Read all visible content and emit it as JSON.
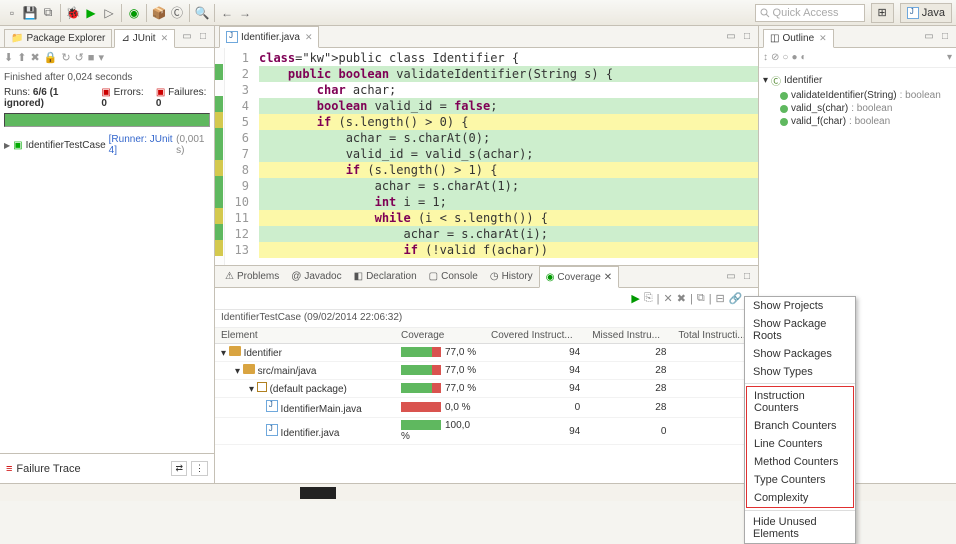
{
  "toolbar": {
    "quick_access_placeholder": "Quick Access",
    "perspective_label": "Java"
  },
  "left_tabs": {
    "pkg_explorer": "Package Explorer",
    "junit": "JUnit"
  },
  "junit": {
    "finished": "Finished after 0,024 seconds",
    "runs_label": "Runs:",
    "runs_value": "6/6 (1 ignored)",
    "errors_label": "Errors:",
    "errors_value": "0",
    "failures_label": "Failures:",
    "failures_value": "0",
    "testcase": "IdentifierTestCase",
    "runner": "[Runner: JUnit 4]",
    "time": "(0,001 s)",
    "failure_trace_label": "Failure Trace"
  },
  "editor": {
    "filename": "Identifier.java",
    "lines": [
      {
        "n": 1,
        "cov": "",
        "txt": "public class Identifier {",
        "hl": [
          "public",
          "class"
        ]
      },
      {
        "n": 2,
        "cov": "green",
        "txt": "    public boolean validateIdentifier(String s) {",
        "hl": [
          "public",
          "boolean"
        ]
      },
      {
        "n": 3,
        "cov": "",
        "txt": "        char achar;",
        "hl": [
          "char"
        ]
      },
      {
        "n": 4,
        "cov": "green",
        "txt": "        boolean valid_id = false;",
        "hl": [
          "boolean",
          "false"
        ]
      },
      {
        "n": 5,
        "cov": "yellow",
        "txt": "        if (s.length() > 0) {",
        "hl": [
          "if"
        ]
      },
      {
        "n": 6,
        "cov": "green",
        "txt": "            achar = s.charAt(0);",
        "hl": []
      },
      {
        "n": 7,
        "cov": "green",
        "txt": "            valid_id = valid_s(achar);",
        "hl": []
      },
      {
        "n": 8,
        "cov": "yellow",
        "txt": "            if (s.length() > 1) {",
        "hl": [
          "if"
        ]
      },
      {
        "n": 9,
        "cov": "green",
        "txt": "                achar = s.charAt(1);",
        "hl": []
      },
      {
        "n": 10,
        "cov": "green",
        "txt": "                int i = 1;",
        "hl": [
          "int"
        ]
      },
      {
        "n": 11,
        "cov": "yellow",
        "txt": "                while (i < s.length()) {",
        "hl": [
          "while"
        ]
      },
      {
        "n": 12,
        "cov": "green",
        "txt": "                    achar = s.charAt(i);",
        "hl": []
      },
      {
        "n": 13,
        "cov": "yellow",
        "txt": "                    if (!valid f(achar))",
        "hl": [
          "if"
        ]
      }
    ]
  },
  "bottom_tabs": {
    "problems": "Problems",
    "javadoc": "Javadoc",
    "declaration": "Declaration",
    "console": "Console",
    "history": "History",
    "coverage": "Coverage"
  },
  "coverage": {
    "session": "IdentifierTestCase (09/02/2014 22:06:32)",
    "cols": {
      "element": "Element",
      "coverage": "Coverage",
      "covered": "Covered Instruct...",
      "missed": "Missed Instru...",
      "total": "Total Instructi..."
    },
    "rows": [
      {
        "indent": 0,
        "icon": "folder",
        "name": "Identifier",
        "pct": "77,0 %",
        "g": 77,
        "cov": 94,
        "miss": 28,
        "total": ""
      },
      {
        "indent": 1,
        "icon": "folder",
        "name": "src/main/java",
        "pct": "77,0 %",
        "g": 77,
        "cov": 94,
        "miss": 28,
        "total": ""
      },
      {
        "indent": 2,
        "icon": "pkg",
        "name": "(default package)",
        "pct": "77,0 %",
        "g": 77,
        "cov": 94,
        "miss": 28,
        "total": ""
      },
      {
        "indent": 3,
        "icon": "java",
        "name": "IdentifierMain.java",
        "pct": "0,0 %",
        "g": 0,
        "cov": 0,
        "miss": 28,
        "total": ""
      },
      {
        "indent": 3,
        "icon": "java",
        "name": "Identifier.java",
        "pct": "100,0 %",
        "g": 100,
        "cov": 94,
        "miss": 0,
        "total": ""
      }
    ]
  },
  "outline": {
    "title": "Outline",
    "class": "Identifier",
    "methods": [
      {
        "name": "validateIdentifier(String)",
        "ret": "boolean"
      },
      {
        "name": "valid_s(char)",
        "ret": "boolean"
      },
      {
        "name": "valid_f(char)",
        "ret": "boolean"
      }
    ]
  },
  "ctx": {
    "show_projects": "Show Projects",
    "show_pkg_roots": "Show Package Roots",
    "show_pkgs": "Show Packages",
    "show_types": "Show Types",
    "instr": "Instruction Counters",
    "branch": "Branch Counters",
    "line": "Line Counters",
    "method": "Method Counters",
    "type": "Type Counters",
    "complexity": "Complexity",
    "hide": "Hide Unused Elements"
  }
}
